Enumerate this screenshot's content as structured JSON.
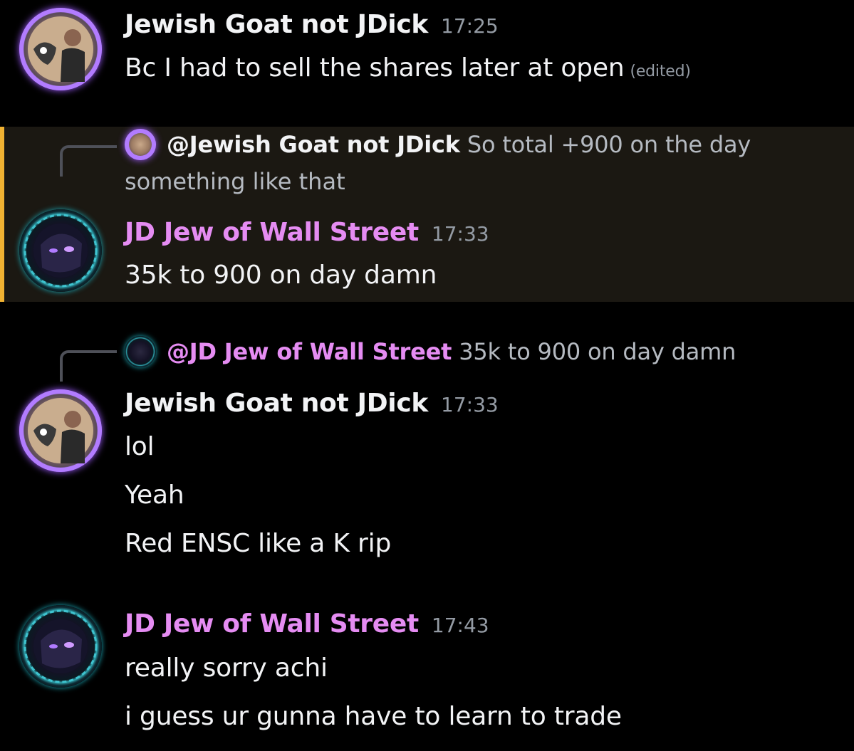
{
  "colors": {
    "background": "#000000",
    "highlight_background": "#1b1812",
    "highlight_bar": "#f0b232",
    "jd_name_color": "#e58cf2",
    "goat_name_color": "#f2f3f5",
    "timestamp_color": "#949ba4"
  },
  "messages": [
    {
      "author": "Jewish Goat not JDick",
      "time": "17:25",
      "lines": [
        "Bc I had to sell the shares later at open"
      ],
      "edited_label": "(edited)",
      "avatar": "goat-avatar"
    },
    {
      "reply": {
        "mention": "@Jewish Goat not JDick",
        "text": "So total +900 on the day",
        "text_cont": "something like that"
      },
      "author": "JD Jew of Wall Street",
      "time": "17:33",
      "lines": [
        "35k to 900 on day damn"
      ],
      "highlighted": true,
      "avatar": "jd-avatar"
    },
    {
      "reply": {
        "mention": "@JD Jew of Wall Street",
        "text": "35k to 900 on day damn"
      },
      "author": "Jewish Goat not JDick",
      "time": "17:33",
      "lines": [
        "lol",
        "Yeah",
        "Red ENSC like a K rip"
      ],
      "avatar": "goat-avatar"
    },
    {
      "author": "JD Jew of Wall Street",
      "time": "17:43",
      "lines": [
        "really sorry achi",
        "i guess ur gunna have to learn to trade"
      ],
      "avatar": "jd-avatar"
    }
  ]
}
